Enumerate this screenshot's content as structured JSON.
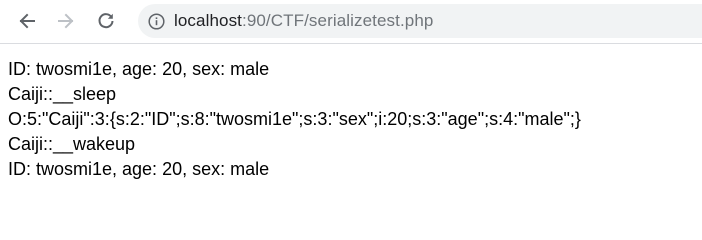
{
  "browser": {
    "url_host": "localhost",
    "url_rest": ":90/CTF/serializetest.php"
  },
  "page": {
    "lines": [
      "ID: twosmi1e, age: 20, sex: male",
      "Caiji::__sleep",
      "O:5:\"Caiji\":3:{s:2:\"ID\";s:8:\"twosmi1e\";s:3:\"sex\";i:20;s:3:\"age\";s:4:\"male\";}",
      "Caiji::__wakeup",
      "ID: twosmi1e, age: 20, sex: male"
    ]
  }
}
